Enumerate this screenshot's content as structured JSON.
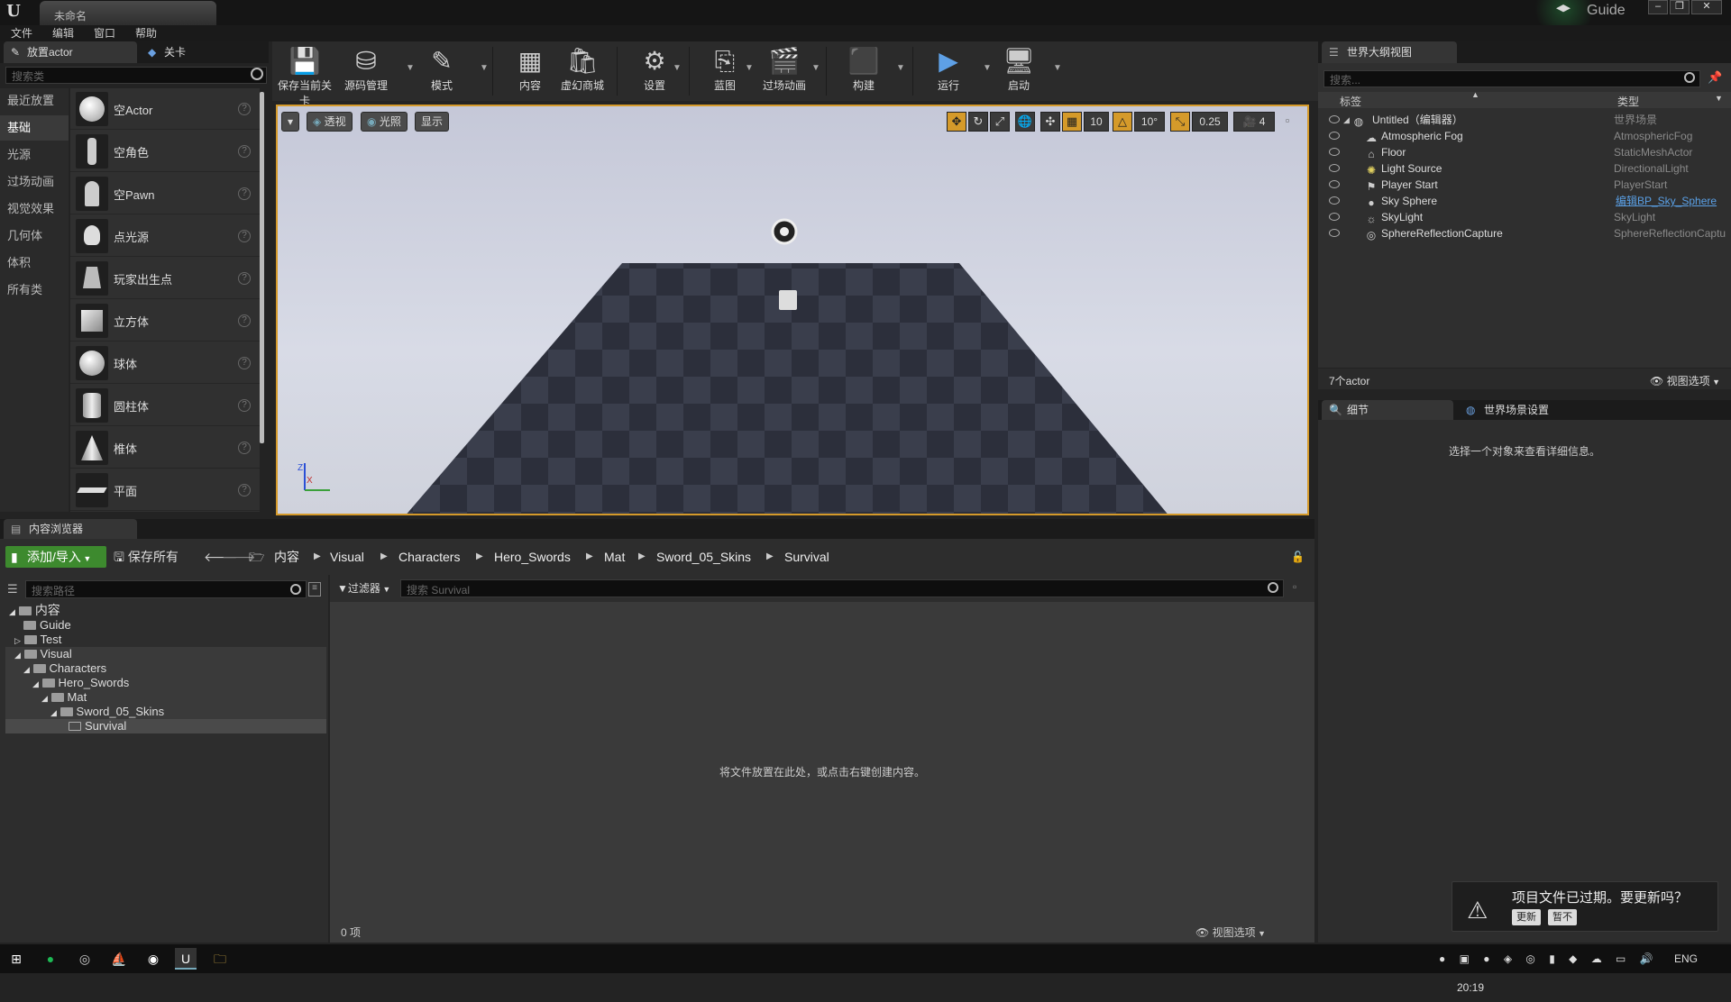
{
  "window": {
    "doc_tab": "未命名",
    "guide": "Guide",
    "minimize": "–",
    "restore": "❐",
    "close": "✕"
  },
  "menu": [
    "文件",
    "编辑",
    "窗口",
    "帮助"
  ],
  "place_panel": {
    "tab_place": "放置actor",
    "tab_levels": "关卡",
    "search_placeholder": "搜索类",
    "categories": [
      "最近放置",
      "基础",
      "光源",
      "过场动画",
      "视觉效果",
      "几何体",
      "体积",
      "所有类"
    ],
    "active_category": "基础",
    "items": [
      "空Actor",
      "空角色",
      "空Pawn",
      "点光源",
      "玩家出生点",
      "立方体",
      "球体",
      "圆柱体",
      "椎体",
      "平面"
    ],
    "help_glyph": "?"
  },
  "toolbar": {
    "buttons": [
      "保存当前关卡",
      "源码管理",
      "模式",
      "内容",
      "虚幻商城",
      "设置",
      "蓝图",
      "过场动画",
      "构建",
      "运行",
      "启动"
    ]
  },
  "viewport": {
    "perspective": "透视",
    "lit": "光照",
    "show": "显示",
    "grid_snap": "10",
    "rotation_snap": "10°",
    "scale_snap": "0.25",
    "camera_speed": "4",
    "axis_z": "Z",
    "axis_x": "X"
  },
  "content_browser": {
    "tab": "内容浏览器",
    "add_import": "添加/导入",
    "save_all": "保存所有",
    "breadcrumbs": [
      "内容",
      "Visual",
      "Characters",
      "Hero_Swords",
      "Mat",
      "Sword_05_Skins",
      "Survival"
    ],
    "path_search_placeholder": "搜索路径",
    "filter": "过滤器",
    "asset_search_placeholder": "搜索 Survival",
    "tree": {
      "root": "内容",
      "guide": "Guide",
      "test": "Test",
      "visual": "Visual",
      "characters": "Characters",
      "hero_swords": "Hero_Swords",
      "mat": "Mat",
      "sword_skins": "Sword_05_Skins",
      "survival": "Survival"
    },
    "drop_hint": "将文件放置在此处，或点击右键创建内容。",
    "item_count": "0 项",
    "view_options": "视图选项"
  },
  "outliner": {
    "tab": "世界大纲视图",
    "search_placeholder": "搜索...",
    "col_label": "标签",
    "col_type": "类型",
    "rows": [
      {
        "name": "Untitled（编辑器）",
        "type": "世界场景"
      },
      {
        "name": "Atmospheric Fog",
        "type": "AtmosphericFog"
      },
      {
        "name": "Floor",
        "type": "StaticMeshActor"
      },
      {
        "name": "Light Source",
        "type": "DirectionalLight"
      },
      {
        "name": "Player Start",
        "type": "PlayerStart"
      },
      {
        "name": "Sky Sphere",
        "type": "编辑BP_Sky_Sphere"
      },
      {
        "name": "SkyLight",
        "type": "SkyLight"
      },
      {
        "name": "SphereReflectionCapture",
        "type": "SphereReflectionCaptu"
      }
    ],
    "count": "7个actor",
    "view_options": "视图选项"
  },
  "details": {
    "tab_details": "细节",
    "tab_world": "世界场景设置",
    "empty_msg": "选择一个对象来查看详细信息。"
  },
  "notification": {
    "message": "项目文件已过期。要更新吗？",
    "update": "更新",
    "later": "暂不"
  },
  "taskbar": {
    "lang": "ENG",
    "time": "20:19"
  },
  "colors": {
    "accent_orange": "#d59a2a",
    "add_green": "#3d8a2e",
    "link_blue": "#5aa0e6"
  }
}
